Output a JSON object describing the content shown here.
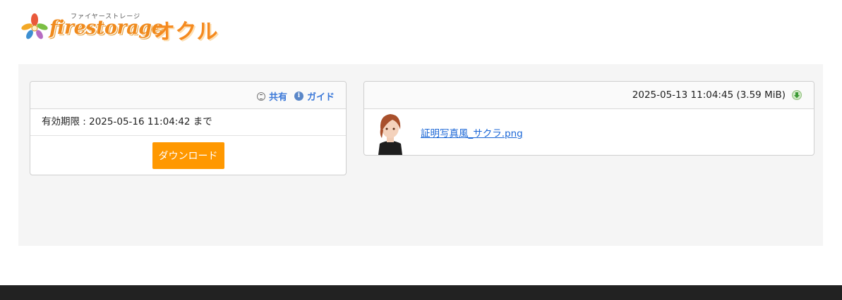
{
  "header": {
    "logo_fire_text": "firestorage",
    "logo_fire_sub": "ファイヤーストレージ",
    "logo_okuru_text": "オクル"
  },
  "left_card": {
    "share_label": "共有",
    "guide_label": "ガイド",
    "expiry_text": "有効期限 : 2025-05-16 11:04:42 まで",
    "download_button": "ダウンロード"
  },
  "right_card": {
    "upload_meta": "2025-05-13 11:04:45 (3.59 MiB)",
    "file_name": "証明写真風_サクラ.png"
  },
  "colors": {
    "accent_orange": "#ff9800",
    "link_blue": "#1a66d6",
    "panel_gray": "#f5f5f5",
    "footer": "#222222"
  },
  "icons": {
    "share": "share-icon",
    "guide": "info-icon",
    "download": "download-icon"
  }
}
